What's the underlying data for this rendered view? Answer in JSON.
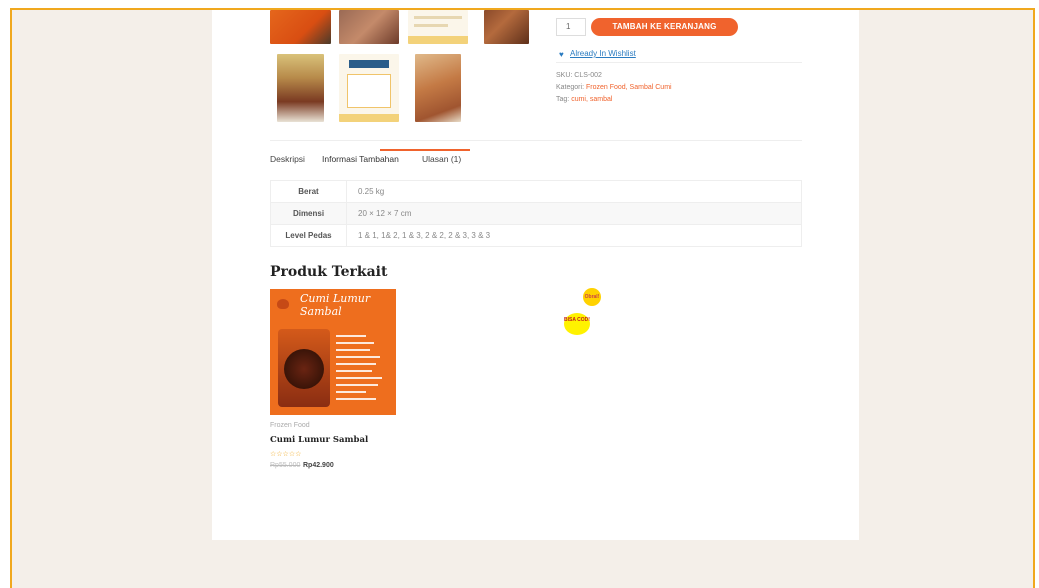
{
  "product": {
    "quantity": "1",
    "add_to_cart_label": "TAMBAH KE KERANJANG",
    "wishlist_label": "Already In Wishlist",
    "sku_label": "SKU:",
    "sku_value": "CLS-002",
    "category_label": "Kategori:",
    "categories": "Frozen Food, Sambal Cumi",
    "tag_label": "Tag:",
    "tags": "cumi, sambal"
  },
  "tabs": [
    {
      "label": "Deskripsi"
    },
    {
      "label": "Informasi Tambahan"
    },
    {
      "label": "Ulasan (1)"
    }
  ],
  "info_table": [
    {
      "key": "Berat",
      "value": "0.25 kg"
    },
    {
      "key": "Dimensi",
      "value": "20 × 12 × 7 cm"
    },
    {
      "key": "Level Pedas",
      "value": "1 & 1, 1& 2, 1 & 3, 2 & 2, 2 & 3, 3 & 3"
    }
  ],
  "related": {
    "title": "Produk Terkait",
    "product": {
      "image_title": "Cumi Lumur Sambal",
      "sale_badge": "Obral!",
      "cod_badge": "BISA COD!",
      "category": "Frozen Food",
      "name": "Cumi Lumur Sambal",
      "price_old": "Rp55.000",
      "price_new": "Rp42.900"
    }
  },
  "colors": {
    "accent": "#f0632d",
    "frame_border": "#f0a81e",
    "frame_bg": "#f4efe9",
    "link_blue": "#2a7bc0"
  }
}
